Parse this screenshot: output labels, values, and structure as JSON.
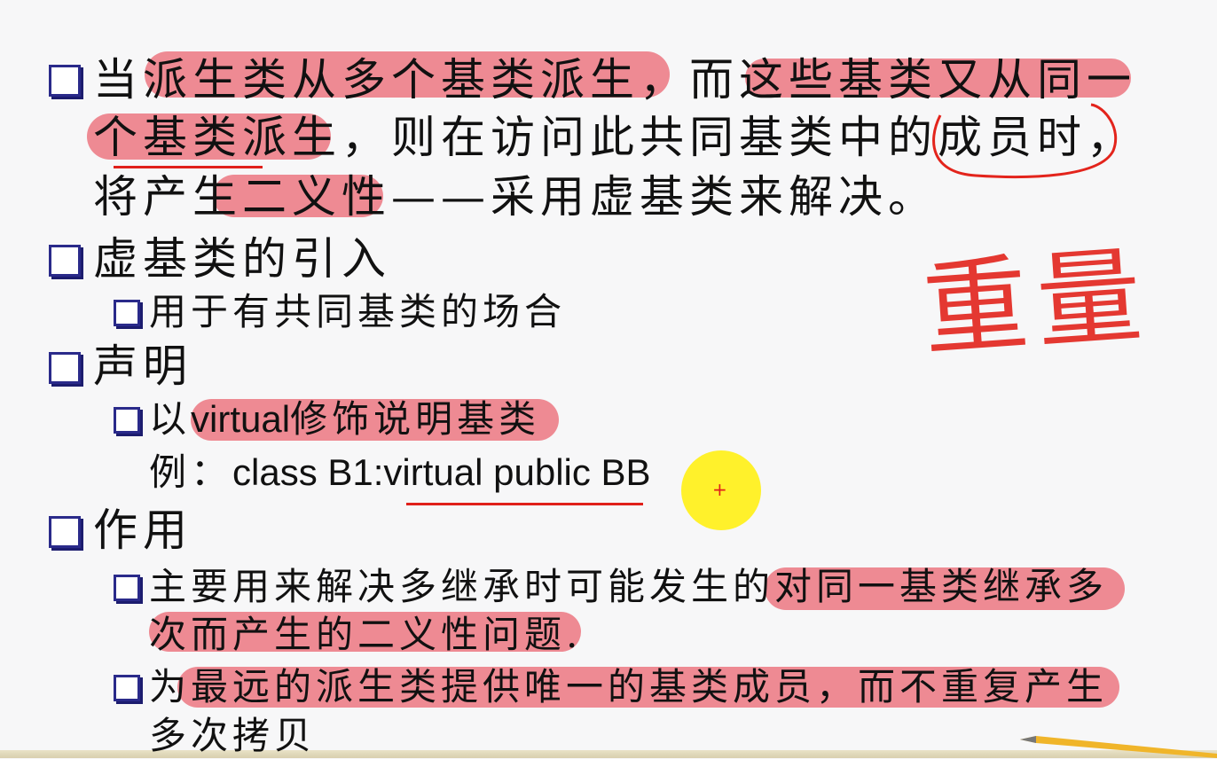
{
  "slide": {
    "items": [
      {
        "level": 1,
        "lines": [
          "当派生类从多个基类派生，而这些基类又从同一",
          "个基类派生，则在访问此共同基类中的成员时，",
          "将产生二义性——采用虚基类来解决。"
        ]
      },
      {
        "level": 1,
        "lines": [
          "虚基类的引入"
        ]
      },
      {
        "level": 2,
        "lines": [
          "用于有共同基类的场合"
        ]
      },
      {
        "level": 1,
        "lines": [
          "声明"
        ]
      },
      {
        "level": 2,
        "prefix": "以",
        "code": "virtual",
        "rest": "修饰说明基类"
      },
      {
        "level": 2,
        "example_label": "例：",
        "example_code": "class B1:virtual public BB"
      },
      {
        "level": 1,
        "lines": [
          "作用"
        ]
      },
      {
        "level": 2,
        "lines": [
          "主要用来解决多继承时可能发生的对同一基类继承多",
          "次而产生的二义性问题."
        ]
      },
      {
        "level": 2,
        "lines": [
          "为最远的派生类提供唯一的基类成员，而不重复产生",
          "多次拷贝"
        ]
      }
    ],
    "handwritten_note": "重量"
  },
  "colors": {
    "highlight": "#ea606c",
    "annotation": "#e3241c",
    "bullet": "#2a2a8a",
    "cursor": "#fff014"
  }
}
